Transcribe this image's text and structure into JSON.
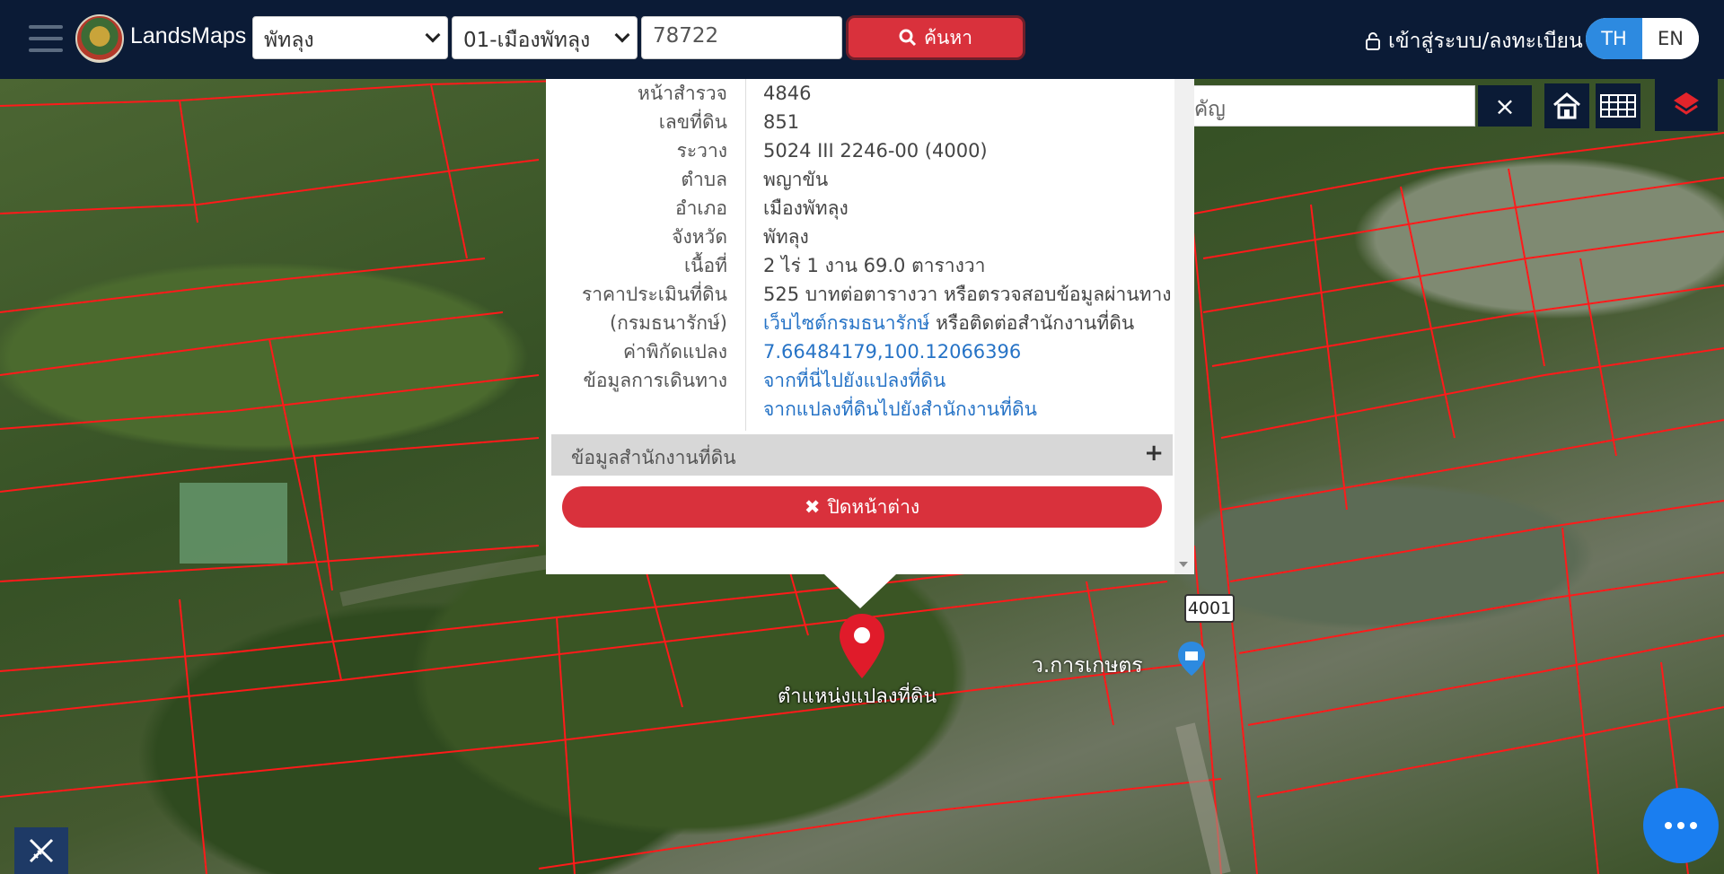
{
  "header": {
    "brand": "LandsMaps",
    "province_select": "พัทลุง",
    "district_select": "01-เมืองพัทลุง",
    "parcel_input": "78722",
    "search_label": "ค้นหา",
    "login_label": "เข้าสู่ระบบ/ลงทะเบียน",
    "lang_th": "TH",
    "lang_en": "EN"
  },
  "map": {
    "search_placeholder": "ค้นหาสถานที่สำคัญ",
    "pin_label": "ตำแหน่งแปลงที่ดิน",
    "road_label": "ว.การเกษตร",
    "route_badge": "4001"
  },
  "popup": {
    "rows": [
      {
        "key": "หน้าสำรวจ",
        "value": "4846"
      },
      {
        "key": "เลขที่ดิน",
        "value": "851"
      },
      {
        "key": "ระวาง",
        "value": "5024 III 2246-00 (4000)"
      },
      {
        "key": "ตำบล",
        "value": "พญาขัน"
      },
      {
        "key": "อำเภอ",
        "value": "เมืองพัทลุง"
      },
      {
        "key": "จังหวัด",
        "value": "พัทลุง"
      },
      {
        "key": "เนื้อที่",
        "value": "2 ไร่ 1 งาน 69.0 ตารางวา"
      },
      {
        "key": "ราคาประเมินที่ดิน",
        "value": "525 บาทต่อตารางวา หรือตรวจสอบข้อมูลผ่านทาง"
      },
      {
        "key": "(กรมธนารักษ์)",
        "link": "เว็บไซต์กรมธนารักษ์",
        "value": " หรือติดต่อสำนักงานที่ดิน"
      },
      {
        "key": "ค่าพิกัดแปลง",
        "link": "7.66484179,100.12066396"
      },
      {
        "key": "ข้อมูลการเดินทาง",
        "link": "จากที่นี่ไปยังแปลงที่ดิน"
      },
      {
        "key": "",
        "link": "จากแปลงที่ดินไปยังสำนักงานที่ดิน"
      }
    ],
    "office_label": "ข้อมูลสำนักงานที่ดิน",
    "close_label": "ปิดหน้าต่าง"
  }
}
